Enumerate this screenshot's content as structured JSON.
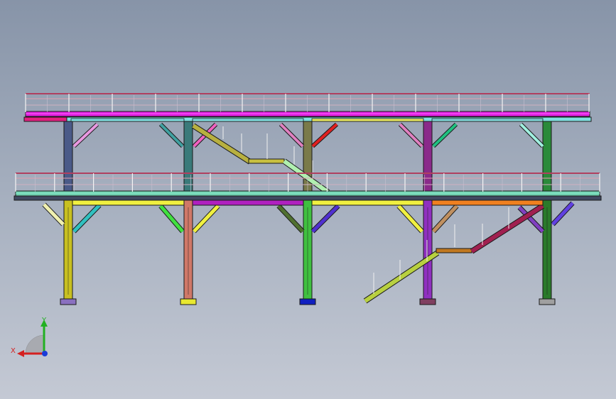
{
  "viewport": {
    "background_top": "#8794a8",
    "background_bottom": "#c4c9d4"
  },
  "triad": {
    "x_label": "X",
    "y_label": "Y",
    "x_color": "#d42020",
    "y_color": "#22b022",
    "z_color": "#1a3cd8"
  },
  "structure": {
    "column_count": 5,
    "deck_levels": 2,
    "railing_color": "#b04060",
    "upper_column_colors": [
      "#4a5a88",
      "#3a7a7a",
      "#7a7a4a",
      "#8a2a8a",
      "#2a8a3a"
    ],
    "lower_column_colors": [
      "#c8c020",
      "#d07868",
      "#40c040",
      "#9030c0",
      "#2a7a2a"
    ],
    "base_plate_colors": [
      "#8a70c0",
      "#e8e830",
      "#1020c0",
      "#804060",
      "#a0a0a0"
    ],
    "upper_beam_colors": [
      "#80e0e0",
      "#80e0e0",
      "#e8e860",
      "#80d8d8"
    ],
    "lower_beam_colors": [
      "#f0f040",
      "#b020c0",
      "#f0f040",
      "#f08020"
    ],
    "upper_bracing_colors": [
      "#e898e0",
      "#40a0a0",
      "#f060c0",
      "#e080c0",
      "#e02020",
      "#e080c0",
      "#20c080",
      "#a0f0e0"
    ],
    "lower_bracing_colors": [
      "#f0f0b0",
      "#30c0c0",
      "#40e040",
      "#f0f040",
      "#507030",
      "#5030d0",
      "#f0f040",
      "#c09060",
      "#8040c0",
      "#6040e0"
    ],
    "stair_colors": [
      "#c8c040",
      "#b0f0b0",
      "#b8d040",
      "#c07820",
      "#a02050"
    ]
  }
}
